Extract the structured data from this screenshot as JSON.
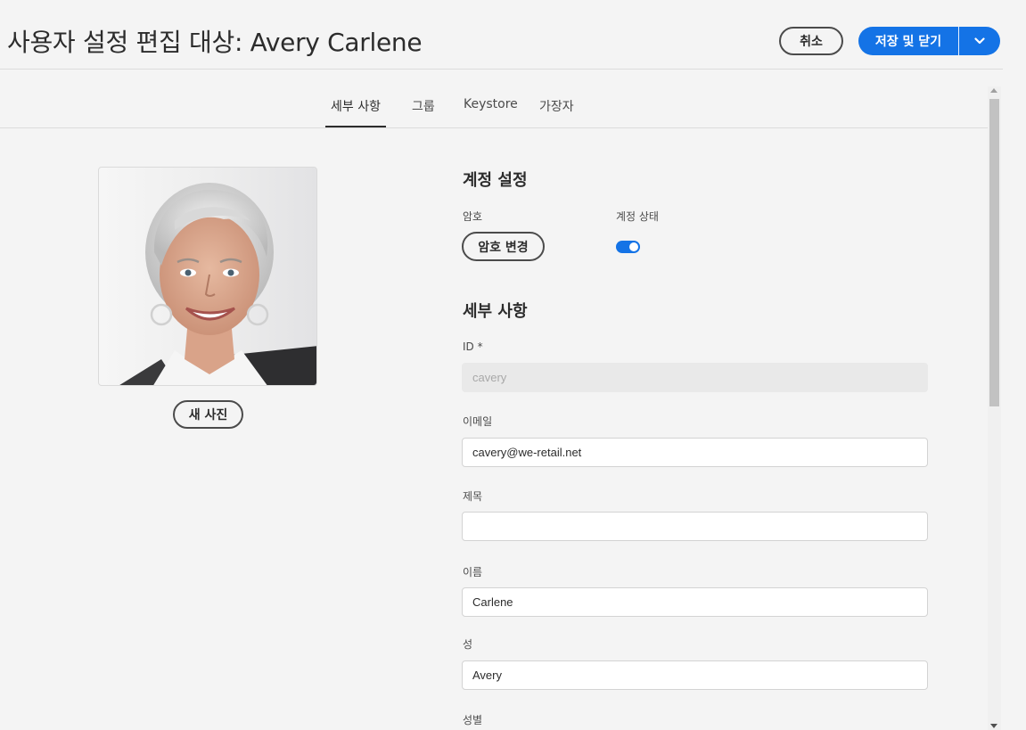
{
  "header": {
    "title": "사용자 설정 편집 대상: Avery Carlene",
    "cancel_label": "취소",
    "save_label": "저장 및 닫기"
  },
  "tabs": [
    {
      "label": "세부 사항",
      "active": true
    },
    {
      "label": "그룹",
      "active": false
    },
    {
      "label": "Keystore",
      "active": false
    },
    {
      "label": "가장자",
      "active": false
    }
  ],
  "profile": {
    "new_photo_label": "새 사진"
  },
  "account_settings": {
    "heading": "계정 설정",
    "password_label": "암호",
    "change_password_label": "암호 변경",
    "status_label": "계정 상태",
    "status_enabled": true
  },
  "details": {
    "heading": "세부 사항",
    "id": {
      "label": "ID *",
      "value": "cavery"
    },
    "email": {
      "label": "이메일",
      "value": "cavery@we-retail.net"
    },
    "title": {
      "label": "제목",
      "value": ""
    },
    "first_name": {
      "label": "이름",
      "value": "Carlene"
    },
    "last_name": {
      "label": "성",
      "value": "Avery"
    },
    "gender": {
      "label": "성별"
    }
  },
  "colors": {
    "accent": "#1473e6",
    "background": "#f4f4f4",
    "text": "#2c2c2c"
  }
}
